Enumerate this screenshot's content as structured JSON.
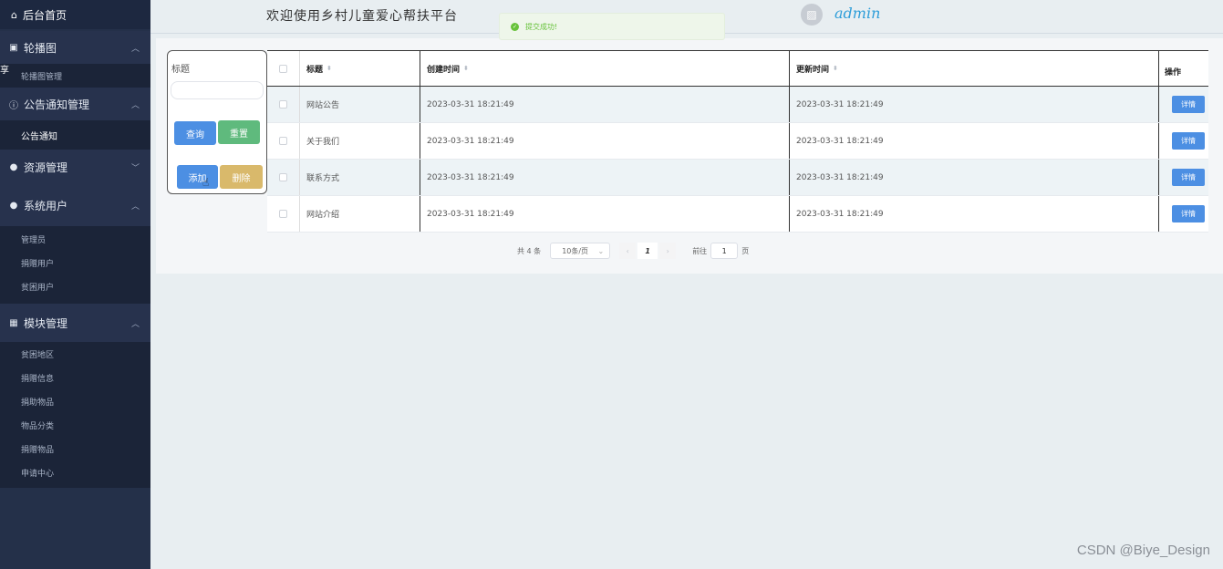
{
  "sidebar": {
    "home": "后台首页",
    "groups": [
      {
        "label": "轮播图",
        "items": [
          {
            "label": "轮播图管理"
          }
        ]
      },
      {
        "label": "公告通知管理",
        "items": [
          {
            "label": "公告通知"
          }
        ]
      },
      {
        "label": "资源管理",
        "items": []
      },
      {
        "label": "系统用户",
        "items": [
          {
            "label": "管理员"
          },
          {
            "label": "捐赠用户"
          },
          {
            "label": "贫困用户"
          }
        ]
      },
      {
        "label": "模块管理",
        "items": [
          {
            "label": "贫困地区"
          },
          {
            "label": "捐赠信息"
          },
          {
            "label": "捐助物品"
          },
          {
            "label": "物品分类"
          },
          {
            "label": "捐赠物品"
          },
          {
            "label": "申请中心"
          }
        ]
      }
    ],
    "edge_mark": "享"
  },
  "header": {
    "title": "欢迎使用乡村儿童爱心帮扶平台",
    "username": "admin",
    "toast": "提交成功!"
  },
  "search": {
    "label": "标题",
    "query_button": "查询",
    "reset_button": "重置",
    "add_button": "添加",
    "delete_button": "删除"
  },
  "table": {
    "columns": [
      "标题",
      "创建时间",
      "更新时间",
      "操作"
    ],
    "rows": [
      {
        "title": "网站公告",
        "created": "2023-03-31 18:21:49",
        "updated": "2023-03-31 18:21:49",
        "action": "详情"
      },
      {
        "title": "关于我们",
        "created": "2023-03-31 18:21:49",
        "updated": "2023-03-31 18:21:49",
        "action": "详情"
      },
      {
        "title": "联系方式",
        "created": "2023-03-31 18:21:49",
        "updated": "2023-03-31 18:21:49",
        "action": "详情"
      },
      {
        "title": "网站介绍",
        "created": "2023-03-31 18:21:49",
        "updated": "2023-03-31 18:21:49",
        "action": "详情"
      }
    ]
  },
  "pagination": {
    "total": "共 4 条",
    "page_size": "10条/页",
    "current_page": "1",
    "goto_label": "前往",
    "goto_value": "1",
    "page_suffix": "页"
  },
  "watermark": "CSDN @Biye_Design"
}
